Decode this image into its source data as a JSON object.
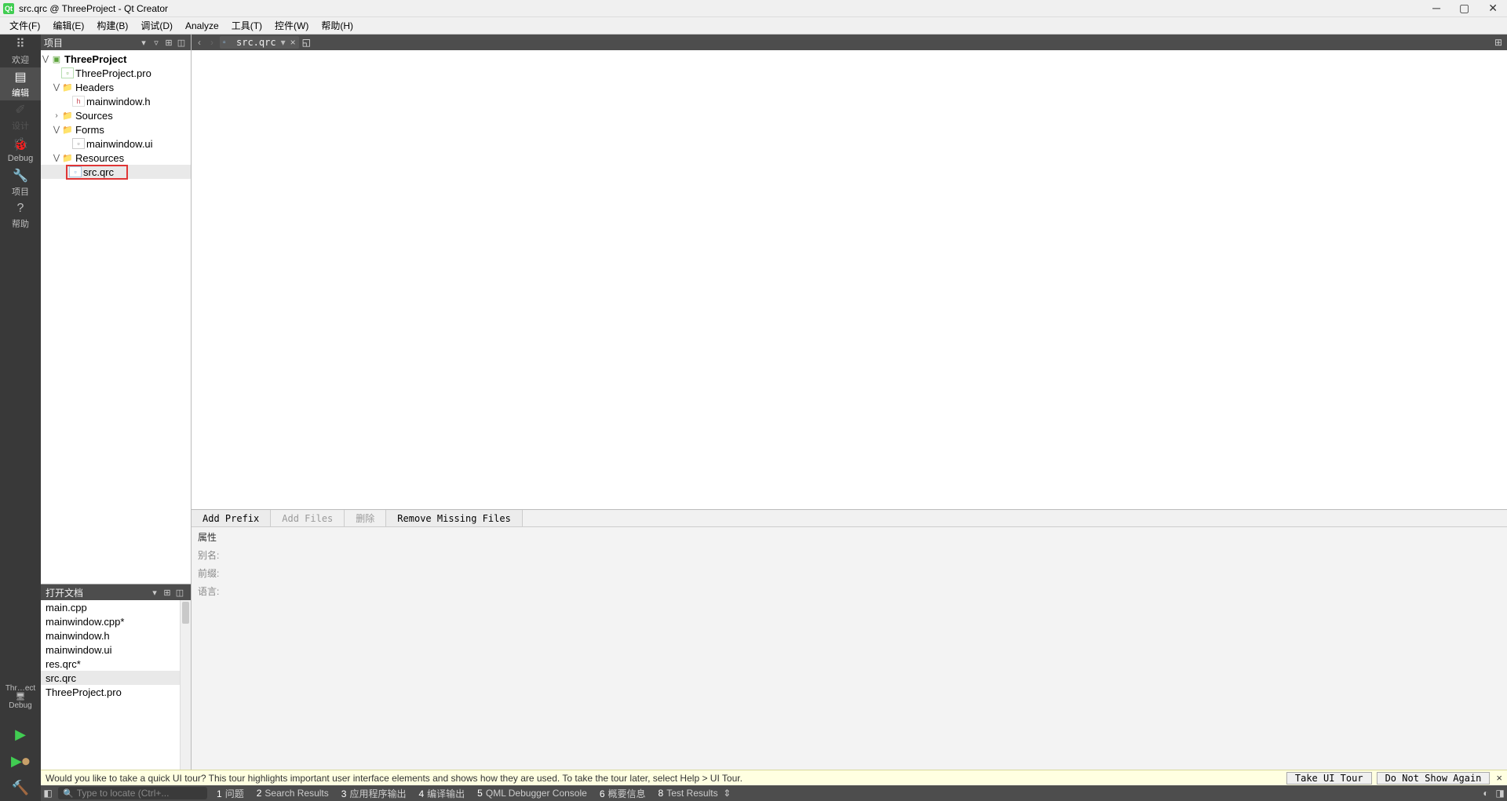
{
  "titlebar": {
    "app_icon_text": "Qt",
    "title": "src.qrc @ ThreeProject - Qt Creator"
  },
  "menubar": {
    "items": [
      "文件(F)",
      "编辑(E)",
      "构建(B)",
      "调试(D)",
      "Analyze",
      "工具(T)",
      "控件(W)",
      "帮助(H)"
    ]
  },
  "modestrip": {
    "items": [
      {
        "icon": "⠿",
        "label": "欢迎"
      },
      {
        "icon": "▤",
        "label": "编辑"
      },
      {
        "icon": "✐",
        "label": "设计"
      },
      {
        "icon": "🐞",
        "label": "Debug"
      },
      {
        "icon": "🔧",
        "label": "项目"
      },
      {
        "icon": "?",
        "label": "帮助"
      }
    ],
    "target_label_top": "Thr…ect",
    "target_label_bottom": "Debug"
  },
  "project_header": {
    "title": "项目"
  },
  "tree": {
    "root": "ThreeProject",
    "root_file": "ThreeProject.pro",
    "headers_label": "Headers",
    "headers_file": "mainwindow.h",
    "sources_label": "Sources",
    "forms_label": "Forms",
    "forms_file": "mainwindow.ui",
    "resources_label": "Resources",
    "resources_file": "src.qrc"
  },
  "tab": {
    "filename": "src.qrc"
  },
  "res_actions": {
    "add_prefix": "Add Prefix",
    "add_files": "Add Files",
    "delete": "删除",
    "remove_missing": "Remove Missing Files"
  },
  "res_props": {
    "title": "属性",
    "alias": "别名:",
    "prefix": "前缀:",
    "language": "语言:"
  },
  "opendocs": {
    "title": "打开文档",
    "items": [
      "main.cpp",
      "mainwindow.cpp*",
      "mainwindow.h",
      "mainwindow.ui",
      "res.qrc*",
      "src.qrc",
      "ThreeProject.pro"
    ]
  },
  "uitour": {
    "text": "Would you like to take a quick UI tour? This tour highlights important user interface elements and shows how they are used. To take the tour later, select Help > UI Tour.",
    "take": "Take UI Tour",
    "dismiss": "Do Not Show Again"
  },
  "statusbar": {
    "search_placeholder": "Type to locate (Ctrl+...",
    "items": [
      {
        "num": "1",
        "label": "问题"
      },
      {
        "num": "2",
        "label": "Search Results"
      },
      {
        "num": "3",
        "label": "应用程序输出"
      },
      {
        "num": "4",
        "label": "编译输出"
      },
      {
        "num": "5",
        "label": "QML Debugger Console"
      },
      {
        "num": "6",
        "label": "概要信息"
      },
      {
        "num": "8",
        "label": "Test Results"
      }
    ]
  }
}
